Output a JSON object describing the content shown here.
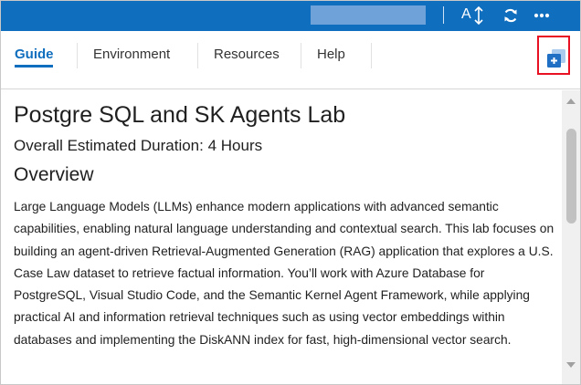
{
  "topbar": {
    "font_size_letter": "A",
    "font_size_icon": "vertical-resize-arrows-icon",
    "refresh_icon": "refresh-icon",
    "more_icon": "more-dots-icon",
    "accent_color": "#106ebe"
  },
  "tabs": [
    {
      "label": "Guide",
      "active": true
    },
    {
      "label": "Environment",
      "active": false
    },
    {
      "label": "Resources",
      "active": false
    },
    {
      "label": "Help",
      "active": false
    }
  ],
  "popout": {
    "icon": "split-window-icon",
    "highlight_color": "#e81123"
  },
  "content": {
    "title": "Postgre SQL and SK Agents Lab",
    "duration": "Overall Estimated Duration: 4 Hours",
    "overview_heading": "Overview",
    "overview_text": "Large Language Models (LLMs) enhance modern applications with advanced semantic capabilities, enabling natural language understanding and contextual search. This lab focuses on building an agent-driven Retrieval-Augmented Generation (RAG) application that explores a U.S. Case Law dataset to retrieve factual information. You’ll work with Azure Database for PostgreSQL, Visual Studio Code, and the Semantic Kernel Agent Framework, while applying practical AI and information retrieval techniques such as using vector embeddings within databases and implementing the DiskANN index for fast, high-dimensional vector search."
  }
}
